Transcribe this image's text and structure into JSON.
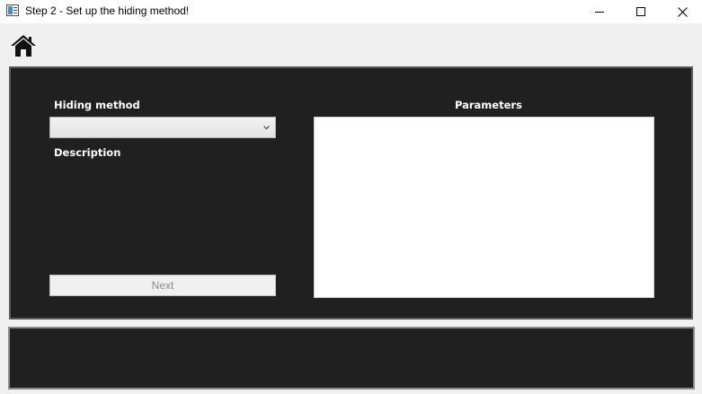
{
  "window": {
    "title": "Step 2 - Set up the hiding method!"
  },
  "titlebar": {
    "icons": [
      "app-icon",
      "minimize-icon",
      "maximize-icon",
      "close-icon"
    ]
  },
  "toolbar": {
    "home_icon": "home-icon"
  },
  "main": {
    "hiding_method_label": "Hiding method",
    "hiding_method_value": "",
    "description_label": "Description",
    "description_text": "",
    "parameters_label": "Parameters",
    "next_label": "Next"
  },
  "colors": {
    "panel_bg": "#202020",
    "window_bg": "#f0f0f0",
    "label_text": "#ffffff",
    "disabled_text": "#8a8a8a"
  }
}
